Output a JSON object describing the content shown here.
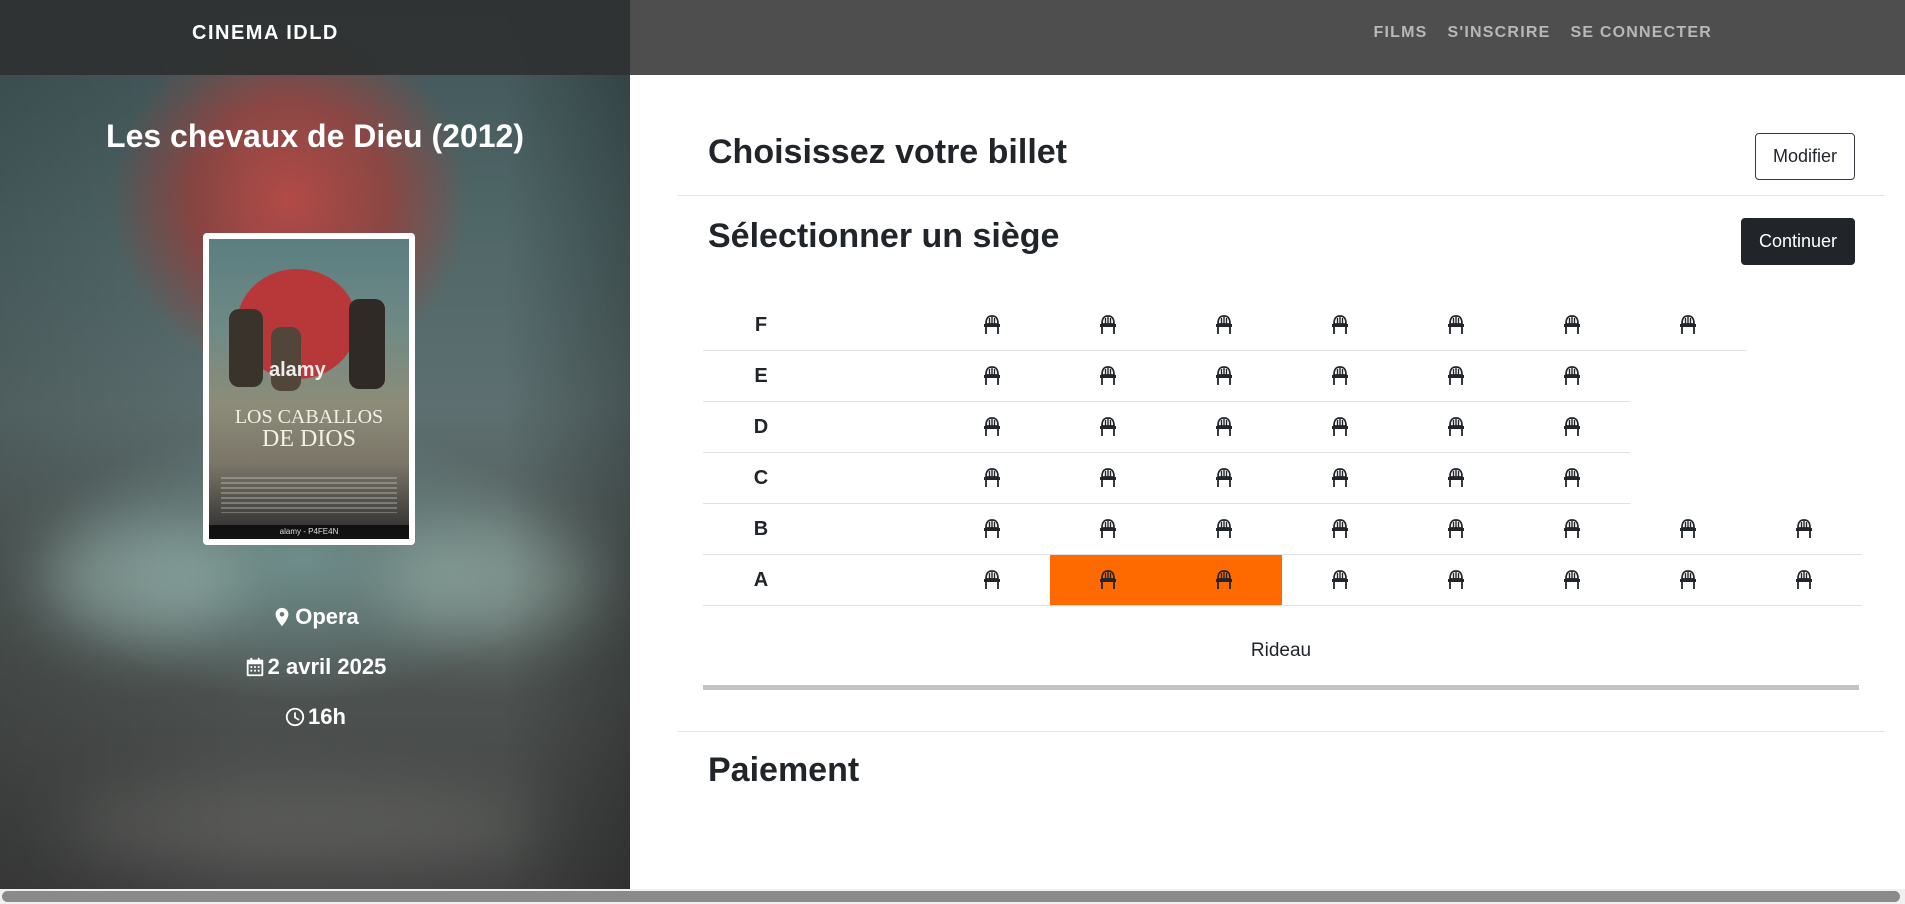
{
  "navbar": {
    "brand": "CINEMA IDLD",
    "links": [
      "FILMS",
      "S'INSCRIRE",
      "SE CONNECTER"
    ]
  },
  "movie": {
    "title": "Les chevaux de Dieu (2012)",
    "location": "Opera",
    "date": "2 avril 2025",
    "time": "16h",
    "poster": {
      "title_line1": "LOS CABALLOS",
      "title_line2": "DE DIOS",
      "watermark": "alamy",
      "credit": "alamy - P4FE4N"
    }
  },
  "ticket_section": {
    "title": "Choisissez votre billet",
    "modify_label": "Modifier"
  },
  "seat_section": {
    "title": "Sélectionner un siège",
    "continue_label": "Continuer",
    "rows": [
      {
        "label": "F",
        "seats": 7,
        "selected": []
      },
      {
        "label": "E",
        "seats": 6,
        "selected": []
      },
      {
        "label": "D",
        "seats": 6,
        "selected": []
      },
      {
        "label": "C",
        "seats": 6,
        "selected": []
      },
      {
        "label": "B",
        "seats": 8,
        "selected": []
      },
      {
        "label": "A",
        "seats": 8,
        "selected": [
          2,
          3
        ]
      }
    ],
    "curtain_label": "Rideau"
  },
  "payment_section": {
    "title": "Paiement"
  },
  "colors": {
    "selected_seat": "#ff6a00",
    "navbar": "#484848",
    "dark_button": "#212529"
  },
  "icons": {
    "seat": "chair-icon",
    "location": "map-pin-icon",
    "date": "calendar-icon",
    "time": "clock-icon"
  }
}
